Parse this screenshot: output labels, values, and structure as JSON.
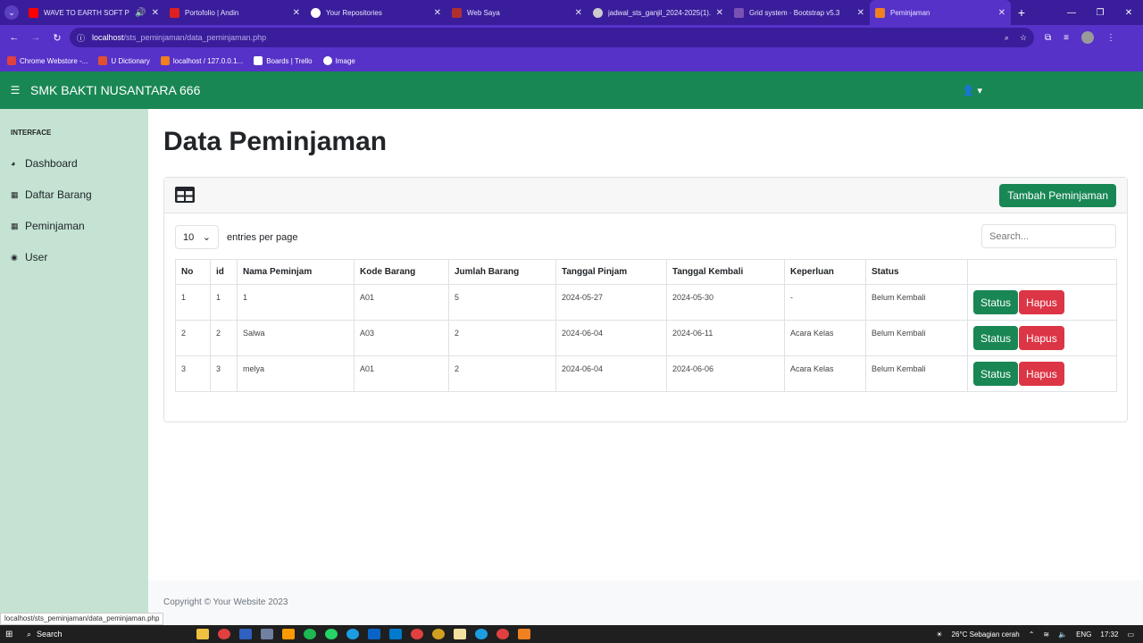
{
  "browser": {
    "tabs": [
      {
        "title": "WAVE TO EARTH SOFT PLA",
        "color": "#ff0000"
      },
      {
        "title": "Portofolio | Andin",
        "color": "#e02020"
      },
      {
        "title": "Your Repositories",
        "color": "#ffffff"
      },
      {
        "title": "Web Saya",
        "color": "#b03030"
      },
      {
        "title": "jadwal_sts_ganjil_2024-2025(1).",
        "color": "#cccccc"
      },
      {
        "title": "Grid system · Bootstrap v5.3",
        "color": "#7952b3"
      },
      {
        "title": "Peminjaman",
        "color": "#f08020"
      }
    ],
    "url_host": "localhost",
    "url_path": "/sts_peminjaman/data_peminjaman.php",
    "bookmarks": [
      {
        "label": "Chrome Webstore -...",
        "color": "#e04040"
      },
      {
        "label": "U Dictionary",
        "color": "#e05030"
      },
      {
        "label": "localhost / 127.0.0.1...",
        "color": "#f08020"
      },
      {
        "label": "Boards | Trello",
        "color": "#ffffff"
      },
      {
        "label": "Image",
        "color": "#ffffff"
      }
    ],
    "status_url": "localhost/sts_peminjaman/data_peminjaman.php"
  },
  "navbar": {
    "brand": "SMK BAKTI NUSANTARA 666"
  },
  "sidebar": {
    "heading": "INTERFACE",
    "items": [
      {
        "label": "Dashboard",
        "icon": "gauge-icon"
      },
      {
        "label": "Daftar Barang",
        "icon": "table-icon"
      },
      {
        "label": "Peminjaman",
        "icon": "table-icon"
      },
      {
        "label": "User",
        "icon": "user-circle-icon"
      }
    ]
  },
  "main": {
    "title": "Data Peminjaman",
    "add_button": "Tambah Peminjaman",
    "entries_value": "10",
    "entries_label": "entries per page",
    "search_placeholder": "Search...",
    "columns": [
      "No",
      "id",
      "Nama Peminjam",
      "Kode Barang",
      "Jumlah Barang",
      "Tanggal Pinjam",
      "Tanggal Kembali",
      "Keperluan",
      "Status",
      ""
    ],
    "rows": [
      {
        "no": "1",
        "id": "1",
        "nama": "1",
        "kode": "A01",
        "jumlah": "5",
        "pinjam": "2024-05-27",
        "kembali": "2024-05-30",
        "keperluan": "-",
        "status": "Belum Kembali"
      },
      {
        "no": "2",
        "id": "2",
        "nama": "Salwa",
        "kode": "A03",
        "jumlah": "2",
        "pinjam": "2024-06-04",
        "kembali": "2024-06-11",
        "keperluan": "Acara Kelas",
        "status": "Belum Kembali"
      },
      {
        "no": "3",
        "id": "3",
        "nama": "melya",
        "kode": "A01",
        "jumlah": "2",
        "pinjam": "2024-06-04",
        "kembali": "2024-06-06",
        "keperluan": "Acara Kelas",
        "status": "Belum Kembali"
      }
    ],
    "status_button": "Status",
    "delete_button": "Hapus"
  },
  "footer": {
    "text": "Copyright © Your Website 2023"
  },
  "taskbar": {
    "search": "Search",
    "weather": "26°C  Sebagian cerah",
    "lang": "ENG",
    "time": "17:32"
  },
  "colors": {
    "brand_green": "#198754",
    "danger_red": "#dc3545",
    "sidebar_bg": "#c4e3d3",
    "browser_purple": "#5632c9"
  }
}
